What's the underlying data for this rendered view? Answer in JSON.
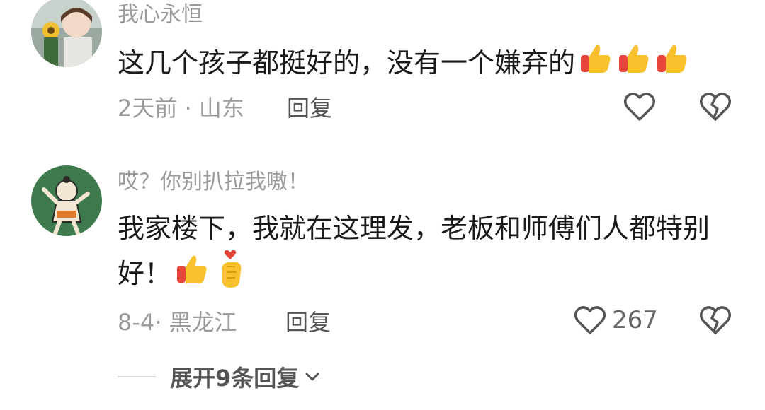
{
  "comments": [
    {
      "username": "我心永恒",
      "text": "这几个孩子都挺好的，没有一个嫌弃的",
      "emojis": [
        "thumbs-up",
        "thumbs-up",
        "thumbs-up"
      ],
      "time": "2天前",
      "location": "山东",
      "reply_label": "回复",
      "like_count": ""
    },
    {
      "username": "哎？你别扒拉我嗷！",
      "text": "我家楼下，我就在这理发，老板和师傅们人都特别好！",
      "emojis": [
        "thumbs-up",
        "finger-heart"
      ],
      "time": "8-4",
      "location": "黑龙江",
      "reply_label": "回复",
      "like_count": "267"
    }
  ],
  "expand_replies_label": "展开9条回复",
  "colors": {
    "meta_gray": "#9a9a9a",
    "text": "#1a1a1a",
    "thumb_yellow": "#f9c12e",
    "thumb_red": "#e8463a"
  }
}
